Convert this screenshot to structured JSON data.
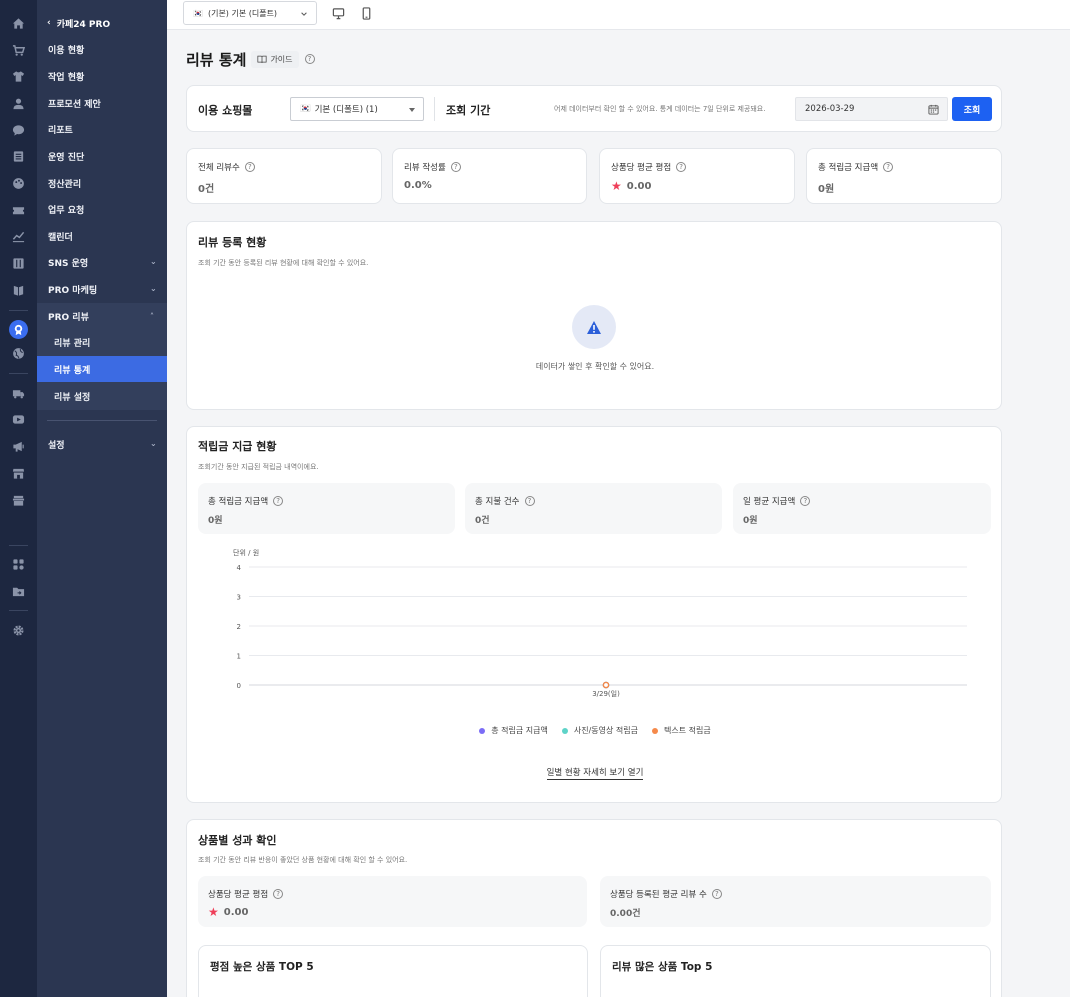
{
  "rail": {
    "icons": [
      "home-icon",
      "cart-icon",
      "shirt-icon",
      "user-icon",
      "chat-icon",
      "list-icon",
      "palette-icon",
      "ticket-icon",
      "chart-icon",
      "board-icon",
      "book-icon",
      "pro-review-icon",
      "globe-icon",
      "truck-icon",
      "video-icon",
      "megaphone-icon",
      "store-icon",
      "shop-icon",
      "apps-icon",
      "folder-icon",
      "gear-icon"
    ]
  },
  "sidebar": {
    "back_label": "카페24 PRO",
    "items": [
      {
        "label": "이용 현황"
      },
      {
        "label": "작업 현황"
      },
      {
        "label": "프로모션 제안"
      },
      {
        "label": "리포트"
      },
      {
        "label": "운영 진단"
      },
      {
        "label": "정산관리"
      },
      {
        "label": "업무 요청"
      },
      {
        "label": "캘린더"
      },
      {
        "label": "SNS 운영"
      },
      {
        "label": "PRO 마케팅"
      },
      {
        "label": "PRO 리뷰"
      }
    ],
    "sub_items": [
      {
        "label": "리뷰 관리"
      },
      {
        "label": "리뷰 통계"
      },
      {
        "label": "리뷰 설정"
      }
    ],
    "settings_label": "설정"
  },
  "topbar": {
    "shop_flag": "🇰🇷",
    "shop_select": "(기본) 기본 (디폴트)"
  },
  "page": {
    "title": "리뷰 통계",
    "guide_label": "가이드"
  },
  "filter": {
    "shop_label": "이용 쇼핑몰",
    "shop_flag": "🇰🇷",
    "shop_value": "기본 (디폴트) (1)",
    "period_label": "조회 기간",
    "note": "어제 데이터부터 확인 할 수 있어요. 통계 데이터는 7일 단위로 제공돼요.",
    "date": "2026-03-29",
    "search_button": "조회"
  },
  "stats": [
    {
      "label": "전체 리뷰수",
      "value": "0건"
    },
    {
      "label": "리뷰 작성률",
      "value": "0.0%"
    },
    {
      "label": "상품당 평균 평점",
      "value": "0.00"
    },
    {
      "label": "총 적립금 지급액",
      "value": "0원"
    }
  ],
  "review_status": {
    "title": "리뷰 등록 현황",
    "desc": "조회 기간 동안 등록된 리뷰 현황에 대해 확인할 수 있어요.",
    "empty_text": "데이터가 쌓인 후 확인할 수 있어요."
  },
  "points": {
    "title": "적립금 지급 현황",
    "desc": "조회기간 동안 지급된 적립금 내역이에요.",
    "cards": [
      {
        "label": "총 적립금 지급액",
        "value": "0원"
      },
      {
        "label": "총 지불 건수",
        "value": "0건"
      },
      {
        "label": "일 평균 지급액",
        "value": "0원"
      }
    ],
    "unit_label": "단위 / 원",
    "legend": [
      {
        "name": "총 적립금 지급액",
        "color": "#7b6cf6"
      },
      {
        "name": "사진/동영상 적립금",
        "color": "#5ed3c8"
      },
      {
        "name": "텍스트 적립금",
        "color": "#f5894a"
      }
    ],
    "more_link": "일별 현황 자세히 보기 열기"
  },
  "chart_data": {
    "type": "line",
    "categories": [
      "3/29(일)"
    ],
    "series": [
      {
        "name": "총 적립금 지급액",
        "values": [
          0
        ]
      },
      {
        "name": "사진/동영상 적립금",
        "values": [
          0
        ]
      },
      {
        "name": "텍스트 적립금",
        "values": [
          0
        ]
      }
    ],
    "yticks": [
      "4",
      "3",
      "2",
      "1",
      "0"
    ],
    "ylim": [
      0,
      4
    ],
    "ylabel": "단위 / 원",
    "grid": true,
    "legend": "bottom"
  },
  "products": {
    "title": "상품별 성과 확인",
    "desc": "조회 기간 동안 리뷰 반응이 좋았던 상품 현황에 대해 확인 할 수 있어요.",
    "cards": [
      {
        "label": "상품당 평균 평점",
        "value": "0.00"
      },
      {
        "label": "상품당 등록된 평균 리뷰 수",
        "value": "0.00건"
      }
    ],
    "top5": [
      {
        "title": "평점 높은 상품 TOP 5"
      },
      {
        "title": "리뷰 많은 상품 Top 5"
      }
    ]
  }
}
